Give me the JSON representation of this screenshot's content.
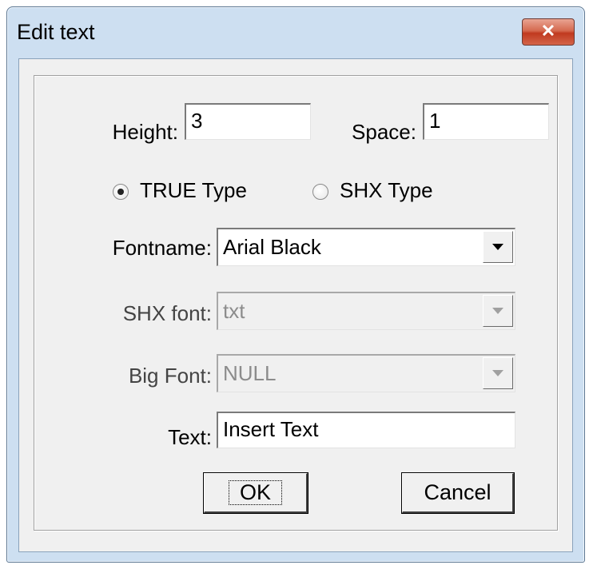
{
  "window": {
    "title": "Edit text",
    "close_label": "✕"
  },
  "fields": {
    "height_label": "Height:",
    "height_value": "3",
    "space_label": "Space:",
    "space_value": "1",
    "fontname_label": "Fontname:",
    "fontname_value": "Arial Black",
    "shx_font_label": "SHX font:",
    "shx_font_value": "txt",
    "big_font_label": "Big Font:",
    "big_font_value": "NULL",
    "text_label": "Text:",
    "text_value": "Insert Text"
  },
  "font_type": {
    "true_type_label": "TRUE Type",
    "shx_type_label": "SHX Type",
    "selected": "TRUE Type"
  },
  "buttons": {
    "ok_label": "OK",
    "cancel_label": "Cancel"
  },
  "colors": {
    "titlebar": "#cddff1",
    "close_button": "#c7432a",
    "dialog_bg": "#f0f0f0"
  }
}
